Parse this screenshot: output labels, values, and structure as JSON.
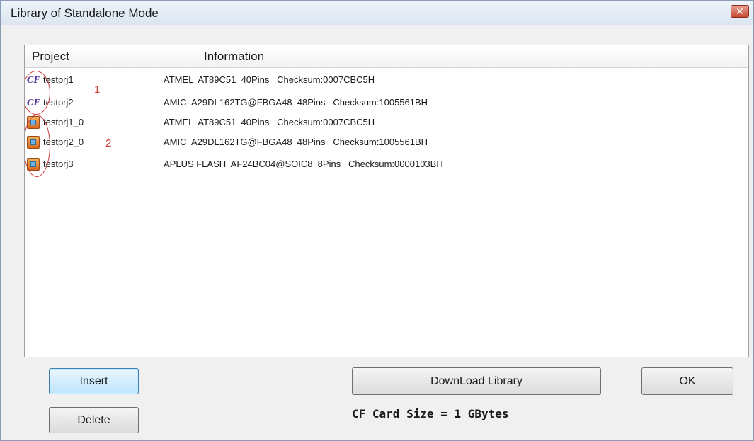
{
  "window": {
    "title": "Library of Standalone Mode",
    "close_glyph": "✕"
  },
  "list": {
    "columns": [
      "Project",
      "Information"
    ],
    "rows": [
      {
        "icon": "cf-card-icon",
        "name": "testprj1",
        "info": "ATMEL  AT89C51  40Pins   Checksum:0007CBC5H"
      },
      {
        "icon": "cf-card-icon",
        "name": "testprj2",
        "info": "AMIC  A29DL162TG@FBGA48  48Pins   Checksum:1005561BH"
      },
      {
        "icon": "bitmap-project-icon",
        "name": "testprj1_0",
        "info": "ATMEL  AT89C51  40Pins   Checksum:0007CBC5H"
      },
      {
        "icon": "bitmap-project-icon",
        "name": "testprj2_0",
        "info": "AMIC  A29DL162TG@FBGA48  48Pins   Checksum:1005561BH"
      },
      {
        "icon": "bitmap-project-icon",
        "name": "testprj3",
        "info": "APLUS FLASH  AF24BC04@SOIC8  8Pins   Checksum:0000103BH"
      }
    ],
    "annotations": [
      "1",
      "2"
    ]
  },
  "buttons": {
    "insert": "Insert",
    "delete": "Delete",
    "download": "DownLoad Library",
    "ok": "OK"
  },
  "status": {
    "cf_card_size": "CF Card Size = 1 GBytes"
  },
  "colors": {
    "annotation": "#d23a3a",
    "default_button": "#bde6fd"
  }
}
